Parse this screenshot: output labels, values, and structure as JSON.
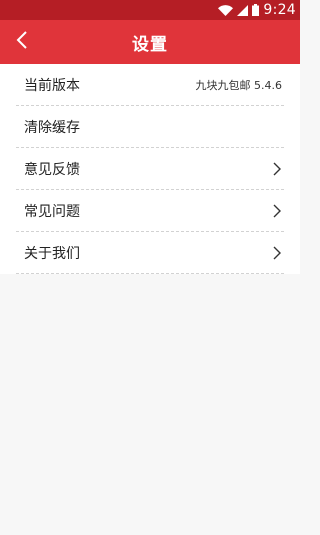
{
  "status_bar": {
    "time": "9:24",
    "icons": [
      "wifi-icon",
      "signal-icon",
      "battery-icon"
    ]
  },
  "header": {
    "title": "设置",
    "back_icon": "chevron-left-icon"
  },
  "settings": {
    "items": [
      {
        "label": "当前版本",
        "value": "九块九包邮 5.4.6",
        "chevron": false
      },
      {
        "label": "清除缓存",
        "value": "",
        "chevron": false
      },
      {
        "label": "意见反馈",
        "value": "",
        "chevron": true
      },
      {
        "label": "常见问题",
        "value": "",
        "chevron": true
      },
      {
        "label": "关于我们",
        "value": "",
        "chevron": true
      }
    ]
  },
  "colors": {
    "status_bar": "#b51e25",
    "header": "#e0343a",
    "background": "#f7f7f7"
  }
}
